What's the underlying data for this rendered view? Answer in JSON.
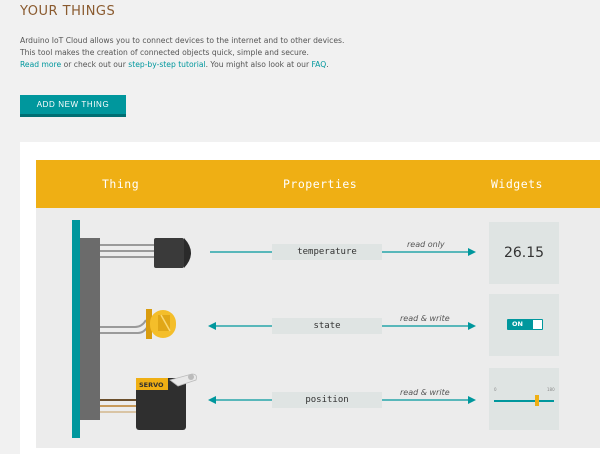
{
  "page": {
    "title": "YOUR THINGS",
    "intro_line1": "Arduino IoT Cloud allows you to connect devices to the internet and to other devices.",
    "intro_line2": "This tool makes the creation of connected objects quick, simple and secure.",
    "read_more": "Read more",
    "intro_mid": " or check out our ",
    "tutorial_link": "step-by-step tutorial",
    "intro_mid2": ". You might also look at our ",
    "faq_link": "FAQ",
    "intro_end": "."
  },
  "toolbar": {
    "add_label": "ADD NEW THING"
  },
  "diagram": {
    "headers": {
      "thing": "Thing",
      "properties": "Properties",
      "widgets": "Widgets"
    },
    "servo_label": "SERVO",
    "rows": [
      {
        "property": "temperature",
        "access": "read only",
        "widget": "value",
        "value": "26.15"
      },
      {
        "property": "state",
        "access": "read & write",
        "widget": "switch",
        "value": "ON"
      },
      {
        "property": "position",
        "access": "read & write",
        "widget": "slider",
        "min": "0",
        "max": "180",
        "level": 0.72
      }
    ]
  },
  "colors": {
    "teal": "#00979d",
    "yellow": "#efaf14",
    "board": "#6b6b6b"
  },
  "icons": [
    "thermometer-sensor-icon",
    "led-icon",
    "servo-motor-icon"
  ]
}
